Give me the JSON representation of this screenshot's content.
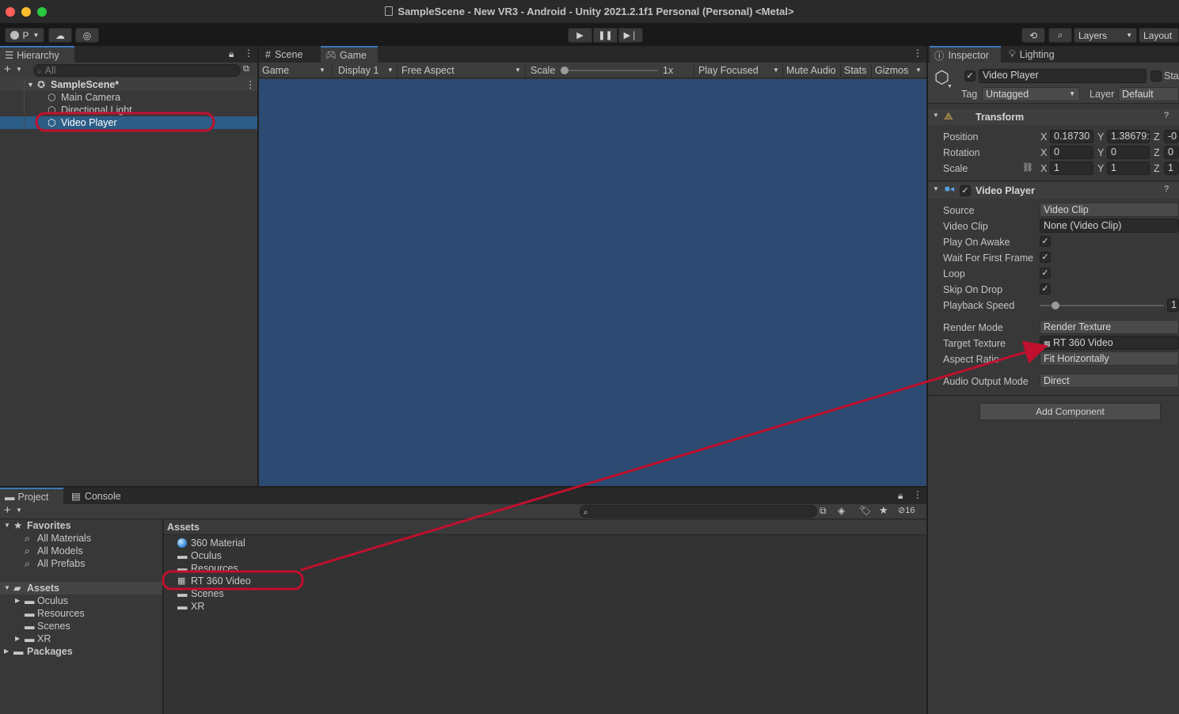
{
  "window": {
    "title": "SampleScene - New VR3 - Android - Unity 2021.2.1f1 Personal (Personal) <Metal>"
  },
  "toolbar": {
    "account_label": "P",
    "layers_label": "Layers",
    "layout_label": "Layout"
  },
  "hierarchy": {
    "tab_label": "Hierarchy",
    "search_placeholder": "All",
    "scene_name": "SampleScene*",
    "items": [
      {
        "label": "Main Camera"
      },
      {
        "label": "Directional Light"
      },
      {
        "label": "Video Player"
      }
    ]
  },
  "scene_view": {
    "tabs": [
      {
        "label": "Scene"
      },
      {
        "label": "Game"
      }
    ],
    "game_toolbar": {
      "display_mode": "Game",
      "display": "Display 1",
      "aspect": "Free Aspect",
      "scale_label": "Scale",
      "scale_value": "1x",
      "play_focused": "Play Focused",
      "mute_audio": "Mute Audio",
      "stats": "Stats",
      "gizmos": "Gizmos"
    },
    "viewport_color": "#2d4a72"
  },
  "inspector": {
    "tabs": [
      {
        "label": "Inspector"
      },
      {
        "label": "Lighting"
      }
    ],
    "object_name": "Video Player",
    "static_label": "Sta",
    "tag_label": "Tag",
    "tag_value": "Untagged",
    "layer_label": "Layer",
    "layer_value": "Default",
    "transform": {
      "title": "Transform",
      "position_label": "Position",
      "rotation_label": "Rotation",
      "scale_label": "Scale",
      "position": {
        "x": "0.18730",
        "y": "1.38679:",
        "z": "-0"
      },
      "rotation": {
        "x": "0",
        "y": "0",
        "z": "0"
      },
      "scale": {
        "x": "1",
        "y": "1",
        "z": "1"
      },
      "axis_x": "X",
      "axis_y": "Y",
      "axis_z": "Z"
    },
    "video_player": {
      "title": "Video Player",
      "source_label": "Source",
      "source_value": "Video Clip",
      "video_clip_label": "Video Clip",
      "video_clip_value": "None (Video Clip)",
      "play_on_awake_label": "Play On Awake",
      "wait_first_frame_label": "Wait For First Frame",
      "loop_label": "Loop",
      "skip_on_drop_label": "Skip On Drop",
      "playback_speed_label": "Playback Speed",
      "playback_speed_value": "1",
      "render_mode_label": "Render Mode",
      "render_mode_value": "Render Texture",
      "target_texture_label": "Target Texture",
      "target_texture_value": "RT 360 Video",
      "aspect_ratio_label": "Aspect Ratio",
      "aspect_ratio_value": "Fit Horizontally",
      "audio_output_label": "Audio Output Mode",
      "audio_output_value": "Direct"
    },
    "add_component_label": "Add Component"
  },
  "project": {
    "tabs": [
      {
        "label": "Project"
      },
      {
        "label": "Console"
      }
    ],
    "hidden_count": "16",
    "favorites": {
      "title": "Favorites",
      "items": [
        {
          "label": "All Materials"
        },
        {
          "label": "All Models"
        },
        {
          "label": "All Prefabs"
        }
      ]
    },
    "tree": {
      "assets_label": "Assets",
      "children": [
        {
          "label": "Oculus"
        },
        {
          "label": "Resources"
        },
        {
          "label": "Scenes"
        },
        {
          "label": "XR"
        }
      ],
      "packages_label": "Packages"
    },
    "breadcrumb": "Assets",
    "files": [
      {
        "label": "360 Material"
      },
      {
        "label": "Oculus"
      },
      {
        "label": "Resources"
      },
      {
        "label": "RT 360 Video"
      },
      {
        "label": "Scenes"
      },
      {
        "label": "XR"
      }
    ]
  },
  "annotation": {
    "color": "#c0102e"
  }
}
